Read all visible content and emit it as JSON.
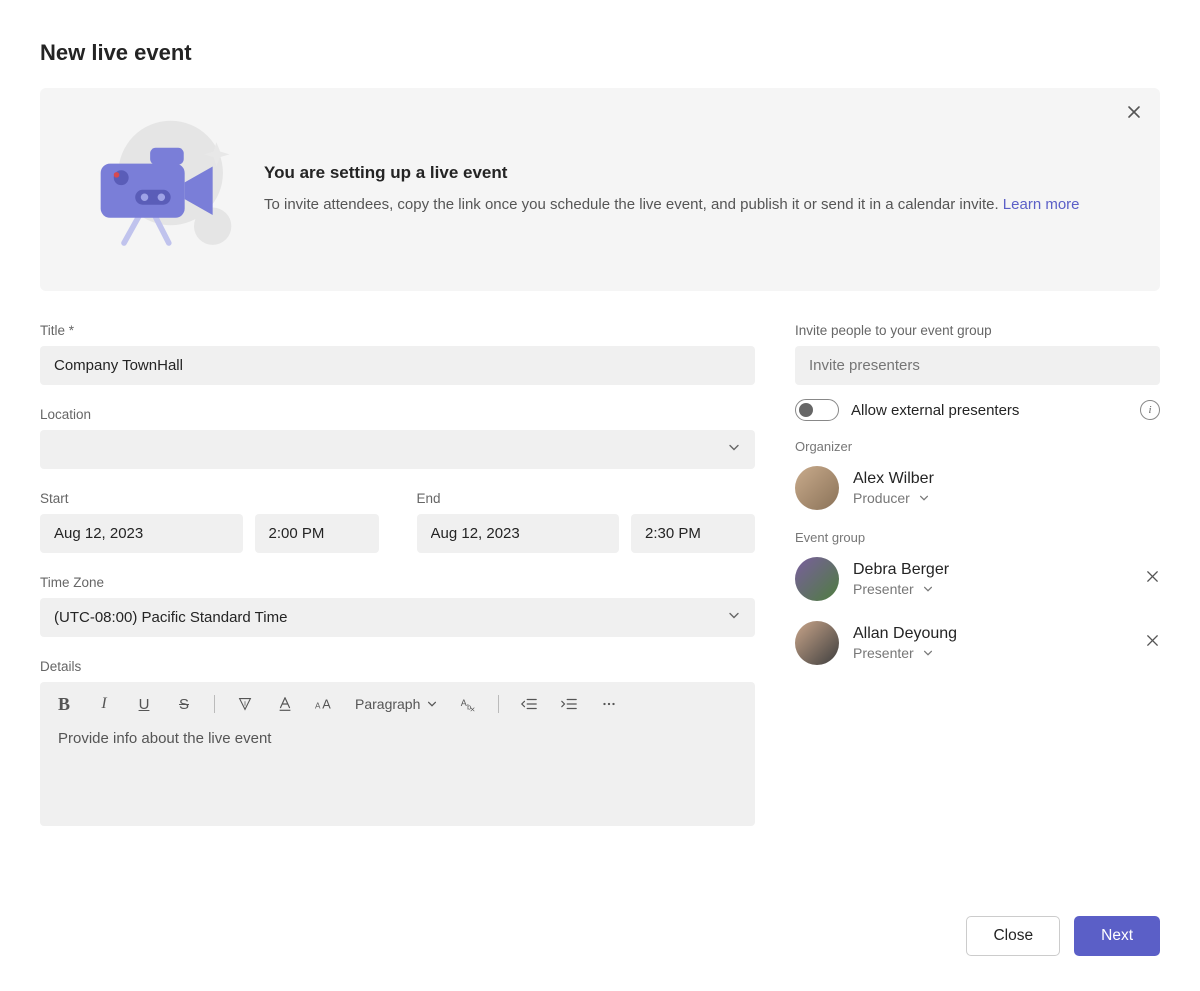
{
  "page": {
    "title": "New live event"
  },
  "banner": {
    "title": "You are setting up a live event",
    "description": "To invite attendees, copy the link once you schedule the live event, and publish it or send it in a calendar invite. ",
    "learn_more": "Learn more"
  },
  "fields": {
    "title_label": "Title *",
    "title_value": "Company TownHall",
    "location_label": "Location",
    "location_value": "",
    "start_label": "Start",
    "start_date": "Aug 12, 2023",
    "start_time": "2:00 PM",
    "end_label": "End",
    "end_date": "Aug 12, 2023",
    "end_time": "2:30 PM",
    "timezone_label": "Time Zone",
    "timezone_value": "(UTC-08:00) Pacific Standard Time",
    "details_label": "Details",
    "details_placeholder": "Provide info about the live event"
  },
  "toolbar": {
    "paragraph": "Paragraph"
  },
  "invite": {
    "label": "Invite people to your event group",
    "placeholder": "Invite presenters",
    "toggle_label": "Allow external presenters",
    "organizer_label": "Organizer",
    "organizer": {
      "name": "Alex Wilber",
      "role": "Producer",
      "avatar_bg": "linear-gradient(135deg,#c9ab8c,#8a7258)"
    },
    "event_group_label": "Event group",
    "members": [
      {
        "name": "Debra Berger",
        "role": "Presenter",
        "avatar_bg": "linear-gradient(135deg,#7a5e9e,#4e7d3f)"
      },
      {
        "name": "Allan Deyoung",
        "role": "Presenter",
        "avatar_bg": "linear-gradient(135deg,#c9a58a,#3e3e3e)"
      }
    ]
  },
  "buttons": {
    "close": "Close",
    "next": "Next"
  }
}
